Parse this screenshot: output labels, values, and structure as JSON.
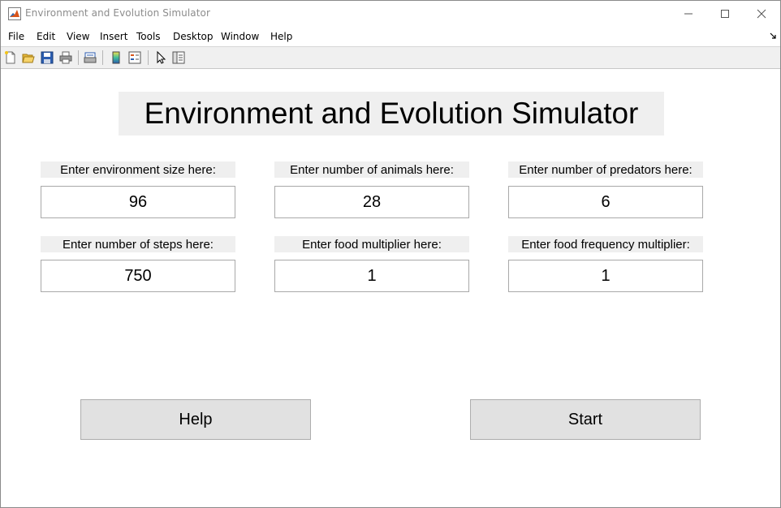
{
  "window": {
    "title": "Environment and Evolution Simulator"
  },
  "menubar": {
    "items": [
      "File",
      "Edit",
      "View",
      "Insert",
      "Tools",
      "Desktop",
      "Window",
      "Help"
    ]
  },
  "toolbar": {
    "icons": [
      "new-figure-icon",
      "open-file-icon",
      "save-icon",
      "print-icon",
      "print-preview-icon",
      "colorbar-icon",
      "legend-icon",
      "pointer-icon",
      "property-inspector-icon"
    ]
  },
  "app": {
    "title": "Environment and Evolution Simulator",
    "fields": [
      {
        "label": "Enter environment size here:",
        "value": "96"
      },
      {
        "label": "Enter number of animals here:",
        "value": "28"
      },
      {
        "label": "Enter number of predators here:",
        "value": "6"
      },
      {
        "label": "Enter number of steps here:",
        "value": "750"
      },
      {
        "label": "Enter food multiplier here:",
        "value": "1"
      },
      {
        "label": "Enter food frequency multiplier:",
        "value": "1"
      }
    ],
    "help_label": "Help",
    "start_label": "Start"
  },
  "colors": {
    "panel_bg": "#efefef",
    "button_bg": "#e1e1e1",
    "toolbar_bg": "#f0f0f0"
  }
}
